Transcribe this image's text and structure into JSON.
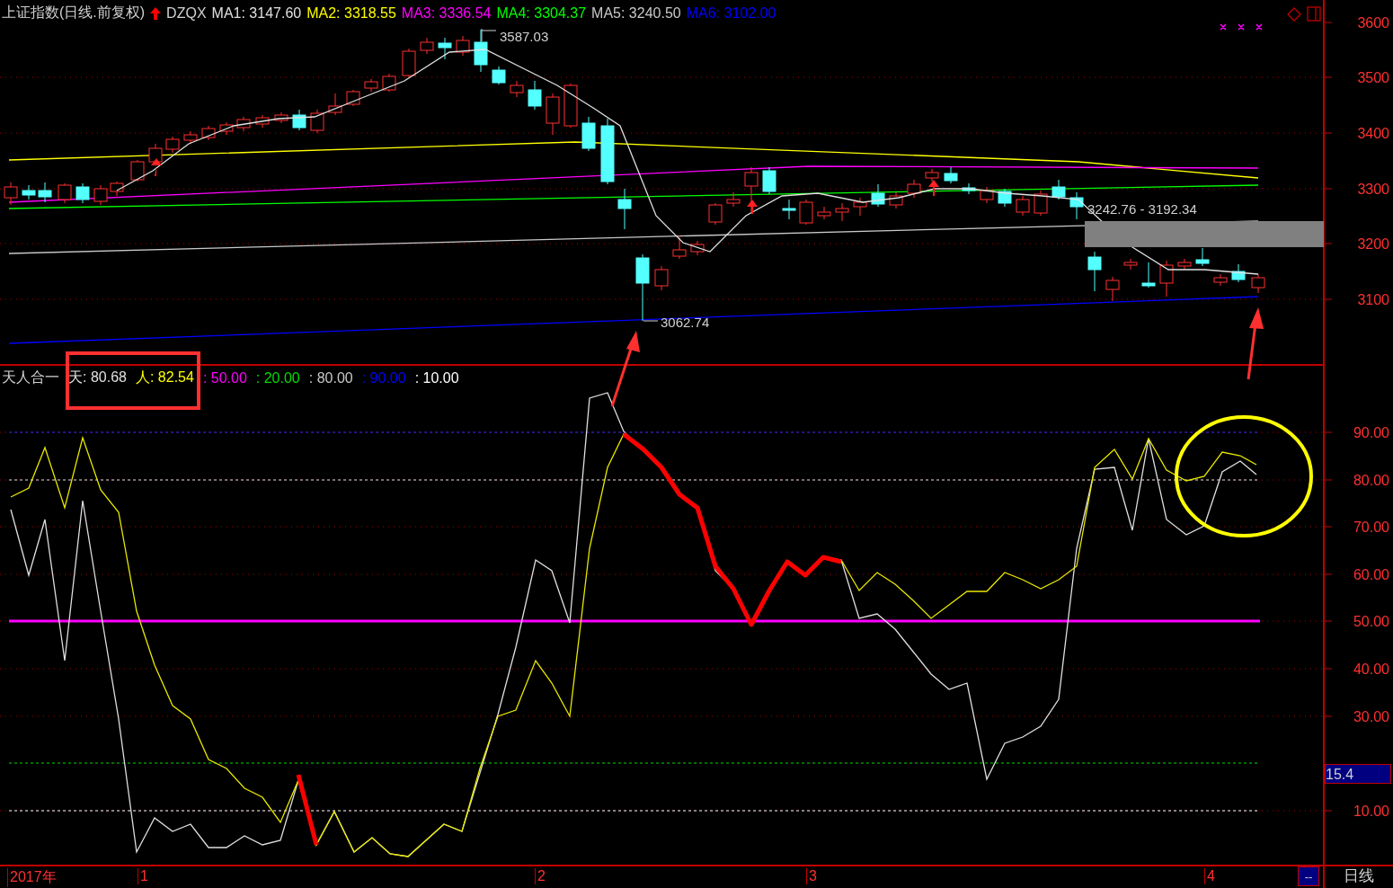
{
  "main_chart": {
    "title": "上证指数(日线.前复权)",
    "symbol": "DZQX",
    "indicators": [
      {
        "label": "MA1: 3147.60",
        "color": "#e0e0e0"
      },
      {
        "label": "MA2: 3318.55",
        "color": "#ffff00"
      },
      {
        "label": "MA3: 3336.54",
        "color": "#ff00ff"
      },
      {
        "label": "MA4: 3304.37",
        "color": "#00ff00"
      },
      {
        "label": "MA5: 3240.50",
        "color": "#c8c8c8"
      },
      {
        "label": "MA6: 3102.00",
        "color": "#0000ff"
      }
    ],
    "annotations": [
      "3587.03",
      "3062.74",
      "3242.76 - 3192.34"
    ],
    "y_axis": [
      "3600",
      "3500",
      "3400",
      "3300",
      "3200",
      "3100"
    ]
  },
  "indicator_panel": {
    "name": "天人合一",
    "values": [
      {
        "label": "天: 80.68",
        "color": "#e0e0e0"
      },
      {
        "label": "人: 82.54",
        "color": "#ffff00"
      },
      {
        "label": ": 50.00",
        "color": "#ff00ff"
      },
      {
        "label": ": 20.00",
        "color": "#00dd00"
      },
      {
        "label": ": 80.00",
        "color": "#c8c8c8"
      },
      {
        "label": ": 90.00",
        "color": "#0000ff"
      },
      {
        "label": ": 10.00",
        "color": "#ffffff"
      }
    ],
    "y_axis": [
      "90.00",
      "80.00",
      "70.00",
      "60.00",
      "50.00",
      "40.00",
      "30.00",
      "10.00"
    ],
    "cursor_value": "15.4"
  },
  "x_axis": {
    "labels": [
      "2017年",
      "1",
      "2",
      "3",
      "4"
    ],
    "scroll_marker": "--",
    "period": "日线"
  }
}
